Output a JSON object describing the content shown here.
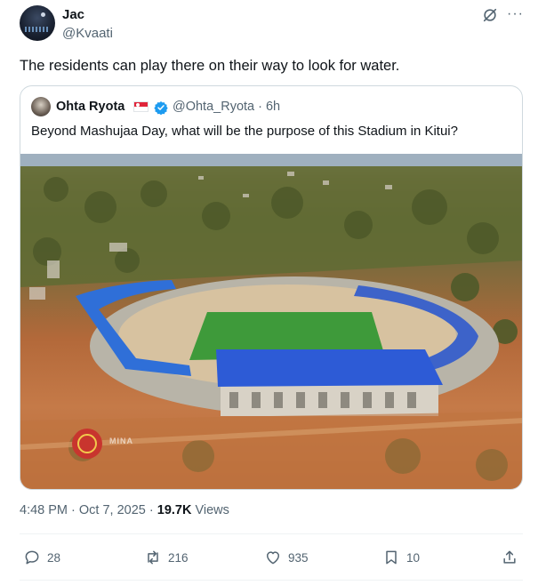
{
  "tweet": {
    "author_name": "Jac",
    "author_handle": "@Kvaati",
    "text": "The residents can play there on their way to look for water.",
    "timestamp": "4:48 PM · Oct 7, 2025",
    "views_count": "19.7K",
    "views_label": "Views"
  },
  "quote": {
    "author_name": "Ohta Ryota",
    "author_handle": "@Ohta_Ryota · 6h",
    "text": "Beyond Mashujaa Day, what will be the purpose of this Stadium in Kitui?",
    "image_watermark": "MINA"
  },
  "actions": {
    "replies": "28",
    "reposts": "216",
    "likes": "935",
    "bookmarks": "10"
  },
  "icons": [
    "grok-icon",
    "more-icon",
    "flag-icon",
    "verified-icon",
    "reply-icon",
    "repost-icon",
    "like-icon",
    "bookmark-icon",
    "share-icon"
  ],
  "colors": {
    "accent": "#1d9bf0",
    "secondary_text": "#536471",
    "border": "#cfd9de"
  }
}
